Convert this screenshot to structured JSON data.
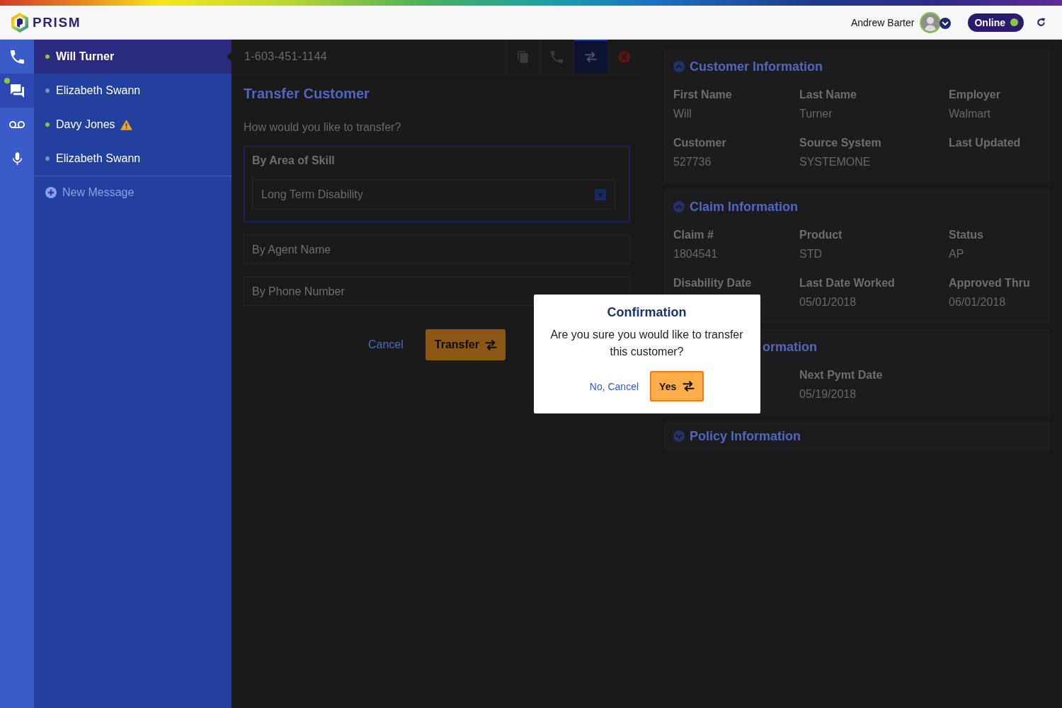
{
  "header": {
    "brand": "PRISM",
    "user_name": "Andrew Barter",
    "status": {
      "label": "Online",
      "on": true
    }
  },
  "rail": [
    {
      "kind": "phone",
      "selected": false,
      "unread": false
    },
    {
      "kind": "chat",
      "selected": true,
      "unread": true
    },
    {
      "kind": "voicemail",
      "selected": false,
      "unread": false
    },
    {
      "kind": "microphone",
      "selected": false,
      "unread": false
    }
  ],
  "conversations": [
    {
      "name": "Will Turner",
      "selected": true,
      "color": "#8cc63f",
      "warning": false
    },
    {
      "name": "Elizabeth Swann",
      "selected": false,
      "color": "#7e8cc4",
      "warning": false
    },
    {
      "name": "Davy Jones",
      "selected": false,
      "color": "#8cc63f",
      "warning": true
    },
    {
      "name": "Elizabeth Swann",
      "selected": false,
      "color": "#7e8cc4",
      "warning": false
    }
  ],
  "new_message": "New Message",
  "call": {
    "number": "1-603-451-1144",
    "actions": [
      {
        "kind": "copy",
        "selected": false
      },
      {
        "kind": "call",
        "selected": false
      },
      {
        "kind": "transfer",
        "selected": true
      },
      {
        "kind": "close",
        "selected": false
      }
    ]
  },
  "transfer": {
    "title": "Transfer Customer",
    "prompt": "How would you like to transfer?",
    "options": [
      {
        "label": "By Area of Skill",
        "selected": true,
        "value": "Long Term Disability"
      },
      {
        "label": "By Agent Name",
        "selected": false
      },
      {
        "label": "By Phone Number",
        "selected": false
      }
    ],
    "cancel": "Cancel",
    "submit": "Transfer"
  },
  "cards": [
    {
      "title": "Customer Information",
      "expanded": true,
      "fields": [
        {
          "label": "First Name",
          "value": "Will"
        },
        {
          "label": "Last Name",
          "value": "Turner"
        },
        {
          "label": "Employer",
          "value": "Walmart"
        },
        {
          "label": "Customer",
          "value": "527736"
        },
        {
          "label": "Source System",
          "value": "SYSTEMONE"
        },
        {
          "label": "Last Updated"
        }
      ]
    },
    {
      "title": "Claim Information",
      "expanded": true,
      "fields": [
        {
          "label": "Claim #",
          "value": "1804541"
        },
        {
          "label": "Product",
          "value": "STD"
        },
        {
          "label": "Status",
          "value": "AP"
        },
        {
          "label": "Disability Date"
        },
        {
          "label": "Last Date Worked",
          "value": "05/01/2018"
        },
        {
          "label": "Approved Thru",
          "value": "06/01/2018"
        }
      ]
    },
    {
      "title": "ormation",
      "expanded": true,
      "covered": true,
      "fields": [
        {
          "label": "Next Pymt Date",
          "value": "05/19/2018"
        }
      ]
    },
    {
      "title": "Policy Information",
      "expanded": false
    }
  ],
  "dialog": {
    "title": "Confirmation",
    "message": "Are you sure you would like to transfer this customer?",
    "cancel": "No, Cancel",
    "confirm": "Yes"
  }
}
